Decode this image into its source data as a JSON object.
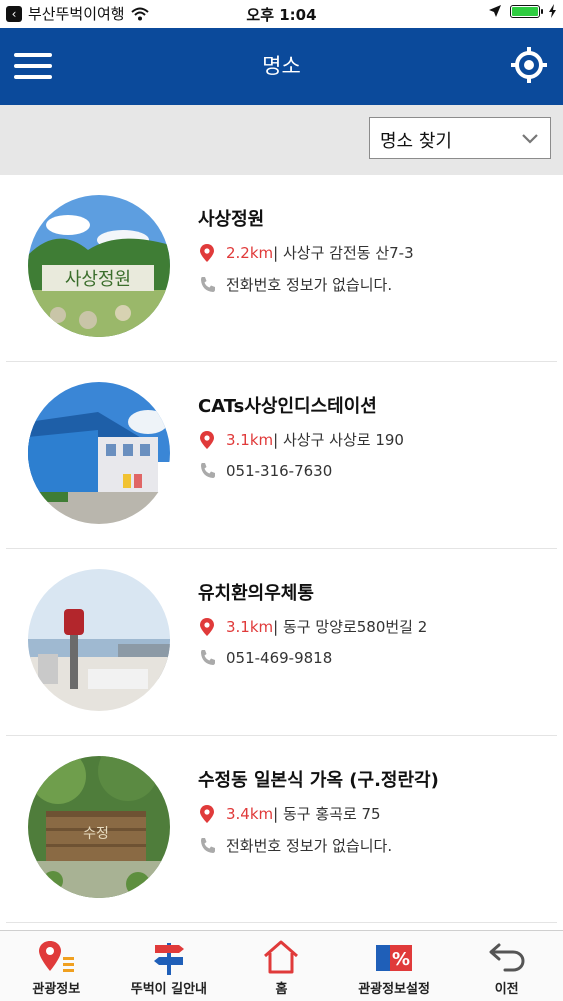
{
  "status_bar": {
    "back_app": "부산뚜벅이여행",
    "time": "오후 1:04"
  },
  "header": {
    "title": "명소"
  },
  "filter": {
    "selected": "명소 찾기"
  },
  "places": [
    {
      "name": "사상정원",
      "distance": "2.2km",
      "address": " | 사상구 감전동 산7-3",
      "phone": "전화번호 정보가 없습니다."
    },
    {
      "name": "CATs사상인디스테이션",
      "distance": "3.1km",
      "address": " | 사상구 사상로 190",
      "phone": "051-316-7630"
    },
    {
      "name": "유치환의우체통",
      "distance": "3.1km",
      "address": " | 동구 망양로580번길 2",
      "phone": "051-469-9818"
    },
    {
      "name": "수정동 일본식 가옥 (구.정란각)",
      "distance": "3.4km",
      "address": " | 동구 홍곡로 75",
      "phone": "전화번호 정보가 없습니다."
    }
  ],
  "bottom_nav": [
    {
      "label": "관광정보",
      "icon": "map-pin-list-icon"
    },
    {
      "label": "뚜벅이 길안내",
      "icon": "signpost-icon"
    },
    {
      "label": "홈",
      "icon": "home-icon"
    },
    {
      "label": "관광정보설정",
      "icon": "percent-card-icon"
    },
    {
      "label": "이전",
      "icon": "undo-arrow-icon"
    }
  ],
  "colors": {
    "header_bg": "#0b4a9b",
    "distance": "#e03a3a",
    "nav_accent_red": "#e03a3a",
    "nav_accent_blue": "#1f5fb8"
  }
}
